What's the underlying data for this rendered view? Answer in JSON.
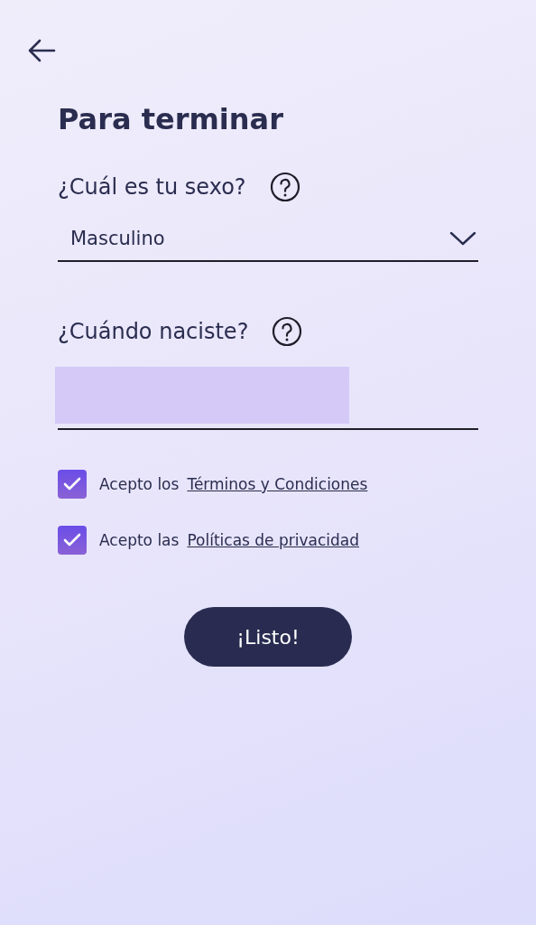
{
  "title": "Para terminar",
  "sex": {
    "label": "¿Cuál es tu sexo?",
    "value": "Masculino"
  },
  "birth": {
    "label": "¿Cuándo naciste?",
    "redacted": true
  },
  "agreements": [
    {
      "text": "Acepto los",
      "link": "Términos y Condiciones",
      "checked": true
    },
    {
      "text": "Acepto las",
      "link": "Políticas de privacidad",
      "checked": true
    }
  ],
  "submit": "¡Listo!"
}
